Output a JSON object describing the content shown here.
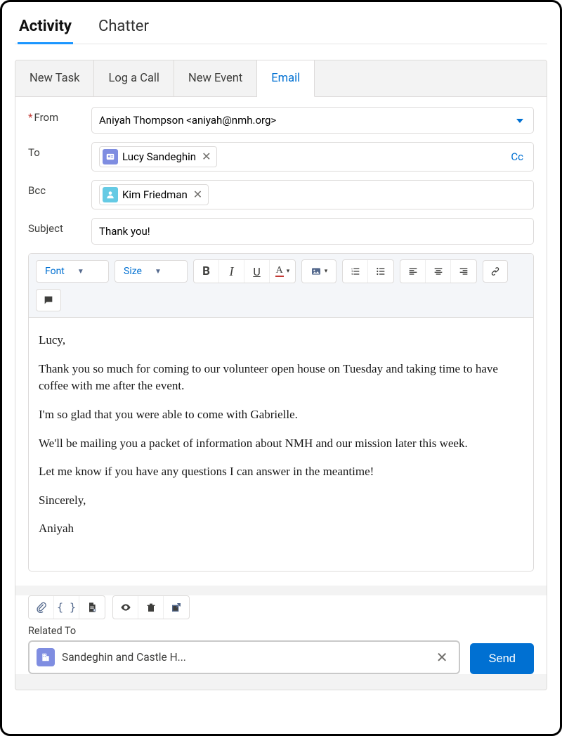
{
  "topTabs": {
    "activity": "Activity",
    "chatter": "Chatter"
  },
  "innerTabs": {
    "newTask": "New Task",
    "logCall": "Log a Call",
    "newEvent": "New Event",
    "email": "Email"
  },
  "labels": {
    "from": "From",
    "to": "To",
    "bcc": "Bcc",
    "subject": "Subject",
    "cc": "Cc",
    "relatedTo": "Related To"
  },
  "from": "Aniyah Thompson <aniyah@nmh.org>",
  "toPill": "Lucy Sandeghin",
  "bccPill": "Kim Friedman",
  "subject": "Thank you!",
  "rte": {
    "font": "Font",
    "size": "Size"
  },
  "body": {
    "p1": "Lucy,",
    "p2": "Thank you so much for coming to our volunteer open house on Tuesday and taking time to have coffee with me after the event.",
    "p3": "I'm so glad that you were able to come with Gabrielle.",
    "p4": "We'll be mailing you a packet of information about NMH and our mission later this week.",
    "p5": "Let me know if you have any questions I can answer in the meantime!",
    "p6": "Sincerely,",
    "p7": "Aniyah"
  },
  "related": "Sandeghin and Castle H...",
  "send": "Send",
  "colors": {
    "toPillIcon": "#7f8de1",
    "bccPillIcon": "#65cae4"
  }
}
